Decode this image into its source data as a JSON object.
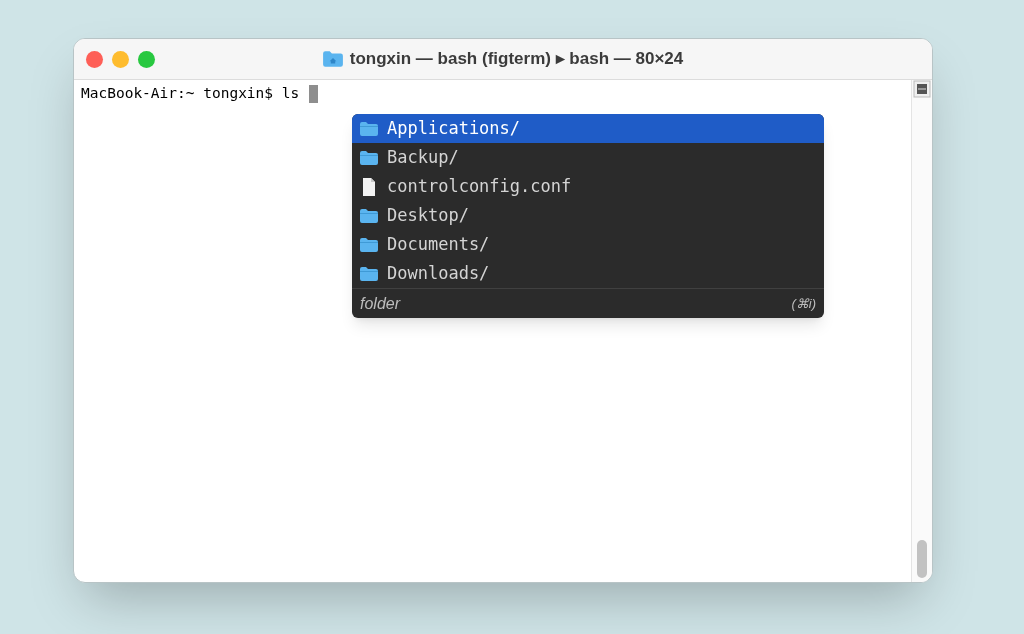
{
  "window": {
    "title": "tongxin — bash (figterm) ▸ bash — 80×24"
  },
  "terminal": {
    "prompt": "MacBook-Air:~ tongxin$ ls"
  },
  "autocomplete": {
    "items": [
      {
        "label": "Applications/",
        "kind": "folder",
        "selected": true
      },
      {
        "label": "Backup/",
        "kind": "folder",
        "selected": false
      },
      {
        "label": "controlconfig.conf",
        "kind": "file",
        "selected": false
      },
      {
        "label": "Desktop/",
        "kind": "folder",
        "selected": false
      },
      {
        "label": "Documents/",
        "kind": "folder",
        "selected": false
      },
      {
        "label": "Downloads/",
        "kind": "folder",
        "selected": false
      }
    ],
    "description": "folder",
    "shortcut": "(⌘i)"
  }
}
